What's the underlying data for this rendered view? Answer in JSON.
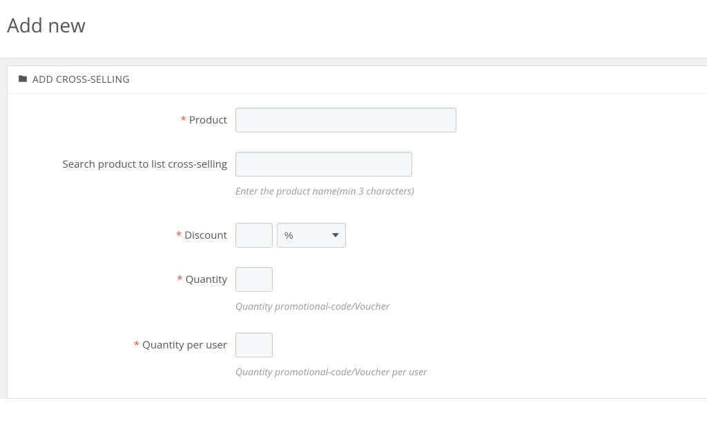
{
  "page": {
    "title": "Add new"
  },
  "panel": {
    "title": "ADD CROSS-SELLING"
  },
  "form": {
    "product": {
      "label": "Product",
      "value": ""
    },
    "search": {
      "label": "Search product to list cross-selling",
      "value": "",
      "help": "Enter the product name(min 3 characters)"
    },
    "discount": {
      "label": "Discount",
      "value": "",
      "unit_selected": "%",
      "unit_options": [
        "%"
      ]
    },
    "quantity": {
      "label": "Quantity",
      "value": "",
      "help": "Quantity promotional-code/Voucher"
    },
    "quantity_per_user": {
      "label": "Quantity per user",
      "value": "",
      "help": "Quantity promotional-code/Voucher per user"
    }
  }
}
